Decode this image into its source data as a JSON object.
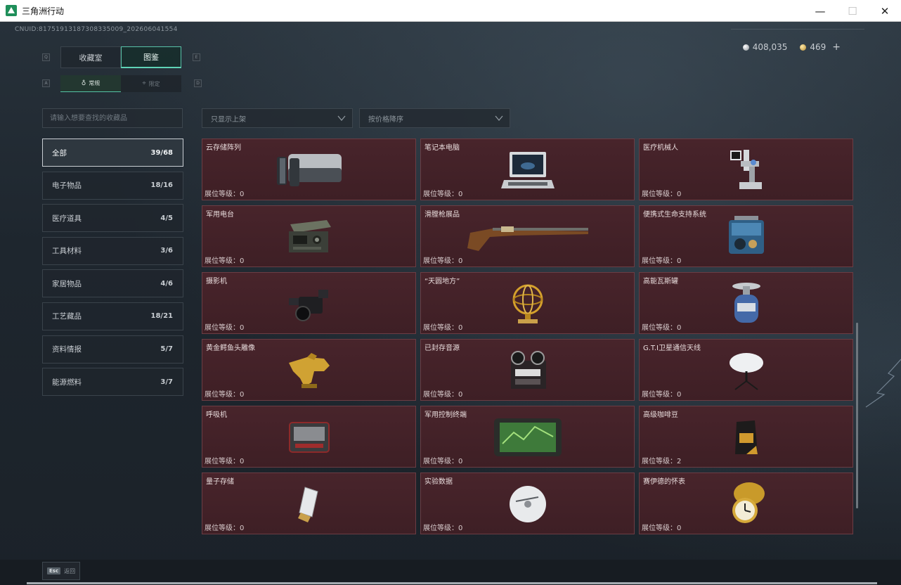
{
  "window": {
    "title": "三角洲行动",
    "controls": {
      "minimize": "—",
      "maximize": "☐",
      "close": "✕"
    }
  },
  "uid": "CNUID:8175191318730833500​9_202606041554",
  "currency": {
    "silver": "408,035",
    "gold": "469",
    "plus": "+"
  },
  "key_hints": {
    "prev_tab": "Q",
    "next_tab": "E",
    "prev_sub": "A",
    "next_sub": "D"
  },
  "main_tabs": [
    {
      "label": "收藏室",
      "active": false
    },
    {
      "label": "图鉴",
      "active": true
    }
  ],
  "sub_tabs": [
    {
      "label": "常规",
      "active": true
    },
    {
      "label": "限定",
      "active": false
    }
  ],
  "search": {
    "placeholder": "请输入想要查找的收藏品"
  },
  "filters": {
    "shelf": "只显示上架",
    "sort": "按价格降序"
  },
  "categories": [
    {
      "label": "全部",
      "count": "39/68",
      "active": true
    },
    {
      "label": "电子物品",
      "count": "18/16",
      "active": false
    },
    {
      "label": "医疗道具",
      "count": "4/5",
      "active": false
    },
    {
      "label": "工具材料",
      "count": "3/6",
      "active": false
    },
    {
      "label": "家居物品",
      "count": "4/6",
      "active": false
    },
    {
      "label": "工艺藏品",
      "count": "18/21",
      "active": false
    },
    {
      "label": "资料情报",
      "count": "5/7",
      "active": false
    },
    {
      "label": "能源燃料",
      "count": "3/7",
      "active": false
    }
  ],
  "items": [
    {
      "name": "云存储阵列",
      "level": "展位等级：0",
      "icon": "server-array-icon"
    },
    {
      "name": "笔记本电脑",
      "level": "展位等级：0",
      "icon": "laptop-icon"
    },
    {
      "name": "医疗机械人",
      "level": "展位等级：0",
      "icon": "medical-robot-icon"
    },
    {
      "name": "军用电台",
      "level": "展位等级：0",
      "icon": "military-radio-icon"
    },
    {
      "name": "滑膛枪展品",
      "level": "展位等级：0",
      "icon": "musket-icon"
    },
    {
      "name": "便携式生命支持系统",
      "level": "展位等级：0",
      "icon": "life-support-icon"
    },
    {
      "name": "摄影机",
      "level": "展位等级：0",
      "icon": "camera-icon"
    },
    {
      "name": "“天圆地方”",
      "level": "展位等级：0",
      "icon": "armillary-sphere-icon"
    },
    {
      "name": "高能瓦斯罐",
      "level": "展位等级：0",
      "icon": "gas-tank-icon"
    },
    {
      "name": "黄金鳄鱼头雕像",
      "level": "展位等级：0",
      "icon": "gold-statue-icon"
    },
    {
      "name": "已封存音源",
      "level": "展位等级：0",
      "icon": "reel-recorder-icon"
    },
    {
      "name": "G.T.I卫星通信天线",
      "level": "展位等级：0",
      "icon": "satellite-dish-icon"
    },
    {
      "name": "呼吸机",
      "level": "展位等级：0",
      "icon": "respirator-icon"
    },
    {
      "name": "军用控制终端",
      "level": "展位等级：0",
      "icon": "control-terminal-icon"
    },
    {
      "name": "高级咖啡豆",
      "level": "展位等级：2",
      "icon": "coffee-bag-icon"
    },
    {
      "name": "量子存储",
      "level": "展位等级：0",
      "icon": "quantum-storage-icon"
    },
    {
      "name": "实验数据",
      "level": "展位等级：0",
      "icon": "data-disc-icon"
    },
    {
      "name": "赛伊德的怀表",
      "level": "展位等级：0",
      "icon": "pocket-watch-icon"
    }
  ],
  "bottom": {
    "esc_key": "Esc",
    "esc_label": "返回"
  },
  "colors": {
    "accent": "#5fd3b6",
    "card_bg": "#46232a",
    "card_border": "#6b3d44"
  }
}
